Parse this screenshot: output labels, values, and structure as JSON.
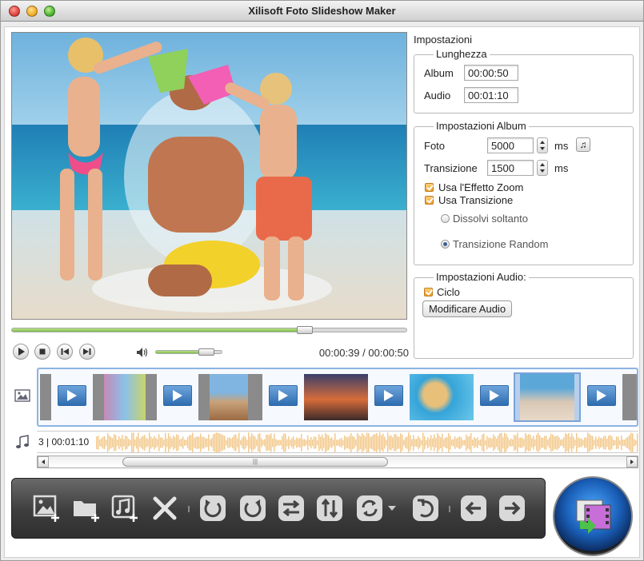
{
  "window": {
    "title": "Xilisoft Foto Slideshow Maker"
  },
  "player": {
    "time_current": "00:00:39",
    "time_separator": "/",
    "time_total": "00:00:50",
    "seek_progress": 0.74,
    "volume_level": 0.75
  },
  "settings": {
    "title": "Impostazioni",
    "length": {
      "legend": "Lunghezza",
      "album_label": "Album",
      "album_value": "00:00:50",
      "audio_label": "Audio",
      "audio_value": "00:01:10"
    },
    "album": {
      "legend": "Impostazioni Album",
      "photo_label": "Foto",
      "photo_value": "5000",
      "photo_unit": "ms",
      "transition_label": "Transizione",
      "transition_value": "1500",
      "transition_unit": "ms",
      "zoom_label": "Usa l'Effetto Zoom",
      "zoom_checked": true,
      "use_transition_label": "Usa Transizione",
      "use_transition_checked": true,
      "dissolve_label": "Dissolvi soltanto",
      "random_label": "Transizione Random",
      "selected_mode": "random"
    },
    "audio": {
      "legend": "Impostazioni Audio:",
      "loop_label": "Ciclo",
      "loop_checked": true,
      "edit_button": "Modificare Audio"
    }
  },
  "timeline": {
    "audio_label": "3 | 00:01:10",
    "thumbnails": [
      "slides",
      "balcony",
      "rocks",
      "sunset",
      "hat",
      "kids-beach"
    ],
    "selected_index": 5
  },
  "toolbar": {
    "buttons": [
      "add-photo",
      "add-folder",
      "add-music",
      "delete",
      "rotate-left",
      "rotate-right",
      "swap",
      "flip-vertical",
      "transition",
      "undo",
      "move-left",
      "move-right"
    ]
  },
  "colors": {
    "accent_orange": "#f0a02a",
    "progress_green": "#7fbf47",
    "toolbar_dark": "#3d3d3d",
    "selection_blue": "#8db4e2",
    "waveform": "#f3c98d"
  }
}
